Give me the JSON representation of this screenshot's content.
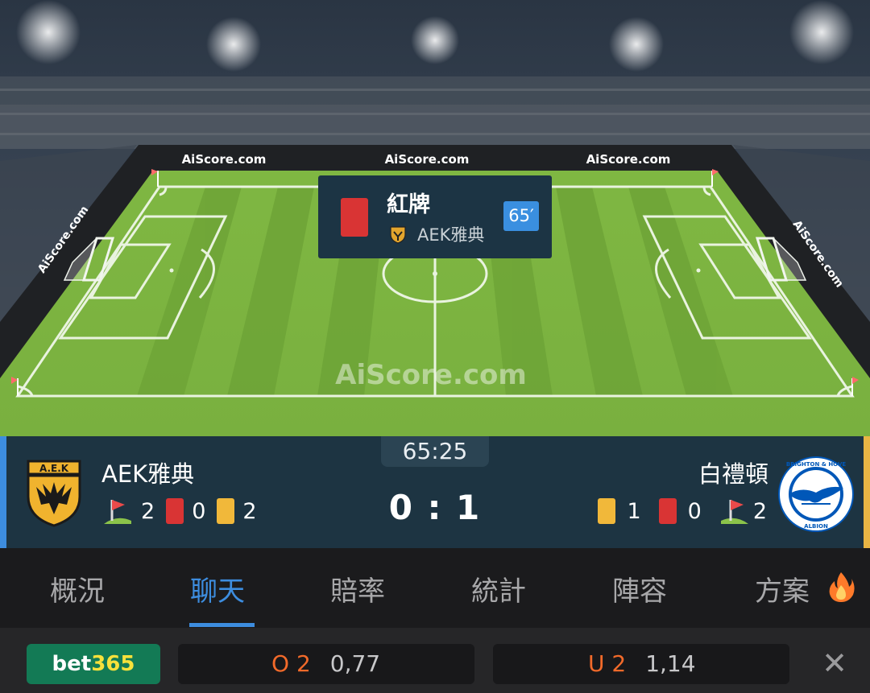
{
  "watermarks": {
    "top_left": "AiScore.com",
    "top_center": "AiScore.com",
    "top_right": "AiScore.com",
    "side_left": "AiScore.com",
    "side_right": "AiScore.com",
    "pitch": "AiScore.com"
  },
  "event": {
    "title": "紅牌",
    "team": "AEK雅典",
    "minute": "65′",
    "type_icon": "red-card-icon"
  },
  "match": {
    "clock": "65:25",
    "score": "0 : 1",
    "home": {
      "name": "AEK雅典",
      "corners": "2",
      "red_cards": "0",
      "yellow_cards": "2",
      "accent": "#3d8ddf"
    },
    "away": {
      "name": "白禮頓",
      "corners": "2",
      "red_cards": "0",
      "yellow_cards": "1",
      "accent": "#e8b544"
    }
  },
  "tabs": [
    {
      "label": "概況"
    },
    {
      "label": "聊天",
      "active": true
    },
    {
      "label": "賠率"
    },
    {
      "label": "統計"
    },
    {
      "label": "陣容"
    },
    {
      "label": "方案",
      "icon": "fire-icon"
    }
  ],
  "odds": {
    "bookmaker_part1": "bet",
    "bookmaker_part2": "365",
    "over_line": "O 2",
    "over_value": "0,77",
    "under_line": "U 2",
    "under_value": "1,14",
    "close_icon": "close-icon"
  },
  "colors": {
    "pitch_light": "#7fb742",
    "pitch_dark": "#6ea437",
    "panel_bg": "#1d3442",
    "active_tab": "#3d8ddf",
    "line_accent": "#f26a2a"
  }
}
